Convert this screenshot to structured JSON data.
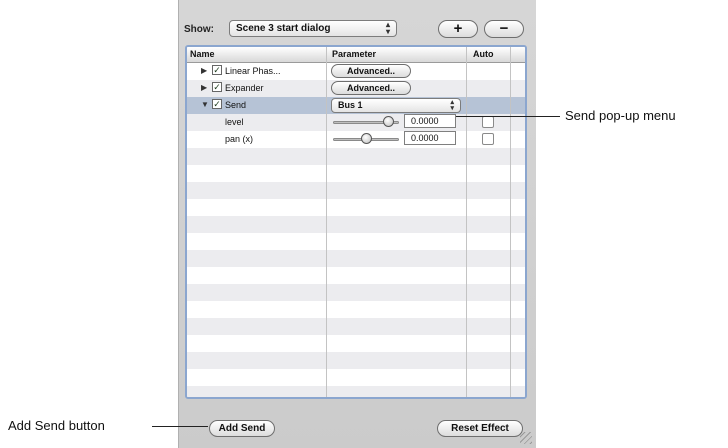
{
  "header": {
    "show_label": "Show:",
    "show_popup_value": "Scene 3 start dialog",
    "add_symbol": "+",
    "remove_symbol": "−"
  },
  "table": {
    "columns": {
      "name": "Name",
      "parameter": "Parameter",
      "auto": "Auto"
    },
    "effects": [
      {
        "name": "Linear Phas...",
        "checked": true,
        "expanded": false,
        "parameter_button": "Advanced.."
      },
      {
        "name": "Expander",
        "checked": true,
        "expanded": false,
        "parameter_button": "Advanced.."
      },
      {
        "name": "Send",
        "checked": true,
        "expanded": true,
        "parameter_popup": "Bus 1",
        "selected": true
      }
    ],
    "params": [
      {
        "name": "level",
        "value": "0.0000",
        "slider_fraction": 0.9
      },
      {
        "name": "pan (x)",
        "value": "0.0000",
        "slider_fraction": 0.5
      }
    ]
  },
  "footer": {
    "add_send_label": "Add Send",
    "reset_effect_label": "Reset Effect"
  },
  "callouts": {
    "send_popup": "Send pop-up menu",
    "add_send": "Add Send button"
  },
  "colors": {
    "selected_row": "#b6c3d6",
    "table_border": "#8ba6cf",
    "stripe_light": "#ffffff",
    "stripe_dark": "#ececef"
  },
  "icons": {
    "checkmark": "checkmark-icon",
    "disclosure_closed": "disclosure-triangle-right-icon",
    "disclosure_open": "disclosure-triangle-down-icon",
    "resize": "resize-grip-icon"
  }
}
